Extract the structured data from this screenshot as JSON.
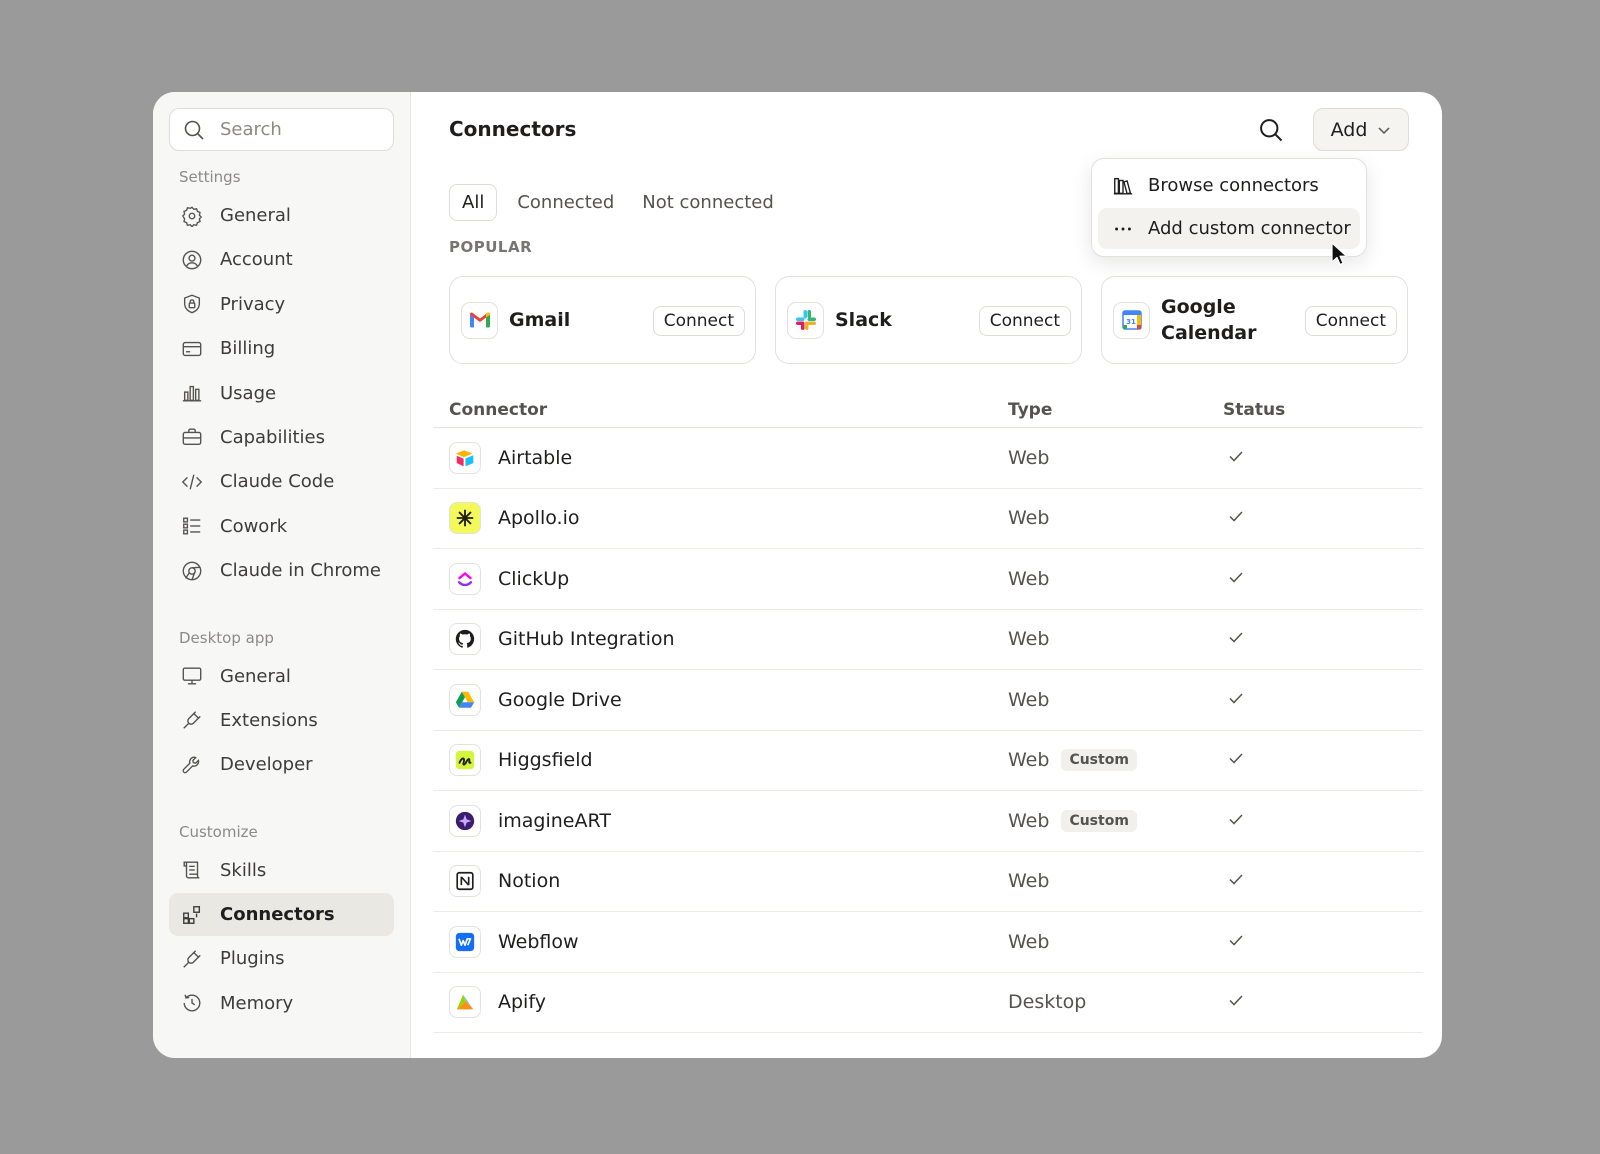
{
  "sidebar": {
    "search_placeholder": "Search",
    "sections": [
      {
        "label": "Settings",
        "items": [
          {
            "label": "General",
            "icon": "gear-icon"
          },
          {
            "label": "Account",
            "icon": "user-circle-icon"
          },
          {
            "label": "Privacy",
            "icon": "shield-lock-icon"
          },
          {
            "label": "Billing",
            "icon": "card-icon"
          },
          {
            "label": "Usage",
            "icon": "bar-chart-icon"
          },
          {
            "label": "Capabilities",
            "icon": "briefcase-icon"
          },
          {
            "label": "Claude Code",
            "icon": "code-icon"
          },
          {
            "label": "Cowork",
            "icon": "checklist-icon"
          },
          {
            "label": "Claude in Chrome",
            "icon": "globe-icon"
          }
        ]
      },
      {
        "label": "Desktop app",
        "items": [
          {
            "label": "General",
            "icon": "monitor-icon"
          },
          {
            "label": "Extensions",
            "icon": "plug-icon"
          },
          {
            "label": "Developer",
            "icon": "wrench-icon"
          }
        ]
      },
      {
        "label": "Customize",
        "items": [
          {
            "label": "Skills",
            "icon": "scroll-icon"
          },
          {
            "label": "Connectors",
            "icon": "grid-plus-icon",
            "active": true
          },
          {
            "label": "Plugins",
            "icon": "plug-icon"
          },
          {
            "label": "Memory",
            "icon": "history-icon"
          }
        ]
      }
    ]
  },
  "header": {
    "title": "Connectors",
    "add_label": "Add"
  },
  "tabs": [
    {
      "label": "All",
      "active": true
    },
    {
      "label": "Connected"
    },
    {
      "label": "Not connected"
    }
  ],
  "popular": {
    "label": "POPULAR",
    "cards": [
      {
        "name": "Gmail",
        "button": "Connect",
        "icon": "gmail-icon"
      },
      {
        "name": "Slack",
        "button": "Connect",
        "icon": "slack-icon"
      },
      {
        "name": "Google Calendar",
        "button": "Connect",
        "icon": "google-calendar-icon"
      }
    ]
  },
  "table": {
    "headers": {
      "connector": "Connector",
      "type": "Type",
      "status": "Status"
    },
    "rows": [
      {
        "name": "Airtable",
        "type": "Web",
        "badge": "",
        "icon": "airtable-icon",
        "status": "check-icon"
      },
      {
        "name": "Apollo.io",
        "type": "Web",
        "badge": "",
        "icon": "apollo-icon",
        "status": "check-icon"
      },
      {
        "name": "ClickUp",
        "type": "Web",
        "badge": "",
        "icon": "clickup-icon",
        "status": "check-icon"
      },
      {
        "name": "GitHub Integration",
        "type": "Web",
        "badge": "",
        "icon": "github-icon",
        "status": "check-icon"
      },
      {
        "name": "Google Drive",
        "type": "Web",
        "badge": "",
        "icon": "google-drive-icon",
        "status": "check-icon"
      },
      {
        "name": "Higgsfield",
        "type": "Web",
        "badge": "Custom",
        "icon": "higgsfield-icon",
        "status": "check-icon"
      },
      {
        "name": "imagineART",
        "type": "Web",
        "badge": "Custom",
        "icon": "imagineart-icon",
        "status": "check-icon"
      },
      {
        "name": "Notion",
        "type": "Web",
        "badge": "",
        "icon": "notion-icon",
        "status": "check-icon"
      },
      {
        "name": "Webflow",
        "type": "Web",
        "badge": "",
        "icon": "webflow-icon",
        "status": "check-icon"
      },
      {
        "name": "Apify",
        "type": "Desktop",
        "badge": "",
        "icon": "apify-icon",
        "status": "check-icon"
      }
    ]
  },
  "dropdown": {
    "items": [
      {
        "label": "Browse connectors",
        "icon": "library-icon"
      },
      {
        "label": "Add custom connector",
        "icon": "more-horizontal-icon"
      }
    ]
  },
  "colors": {
    "accent_bg": "#e9e8e3",
    "overlay": "#9a9a9a"
  }
}
